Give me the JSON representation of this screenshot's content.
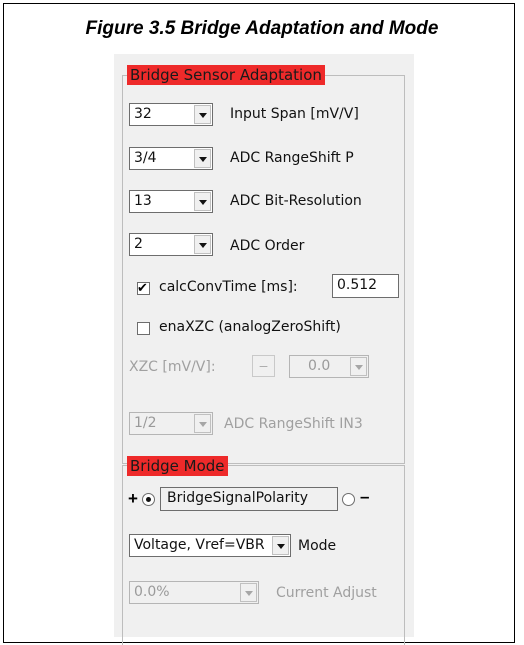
{
  "figure": {
    "title": "Figure 3.5   Bridge Adaptation and Mode"
  },
  "sensor_group": {
    "legend": "Bridge Sensor Adaptation",
    "input_span": {
      "value": "32",
      "label": "Input Span [mV/V]"
    },
    "adc_rangeshift_p": {
      "value": "3/4",
      "label": "ADC RangeShift P"
    },
    "adc_bit_resolution": {
      "value": "13",
      "label": "ADC Bit-Resolution"
    },
    "adc_order": {
      "value": "2",
      "label": "ADC Order"
    },
    "calc_conv_time": {
      "label": "calcConvTime [ms]:",
      "checked": true,
      "check_glyph": "✔",
      "value": "0.512"
    },
    "ena_xzc": {
      "label": "enaXZC (analogZeroShift)",
      "checked": false
    },
    "xzc": {
      "label": "XZC [mV/V]:",
      "button": "–",
      "value": "0.0"
    },
    "adc_rangeshift_in3": {
      "value": "1/2",
      "label": "ADC RangeShift IN3"
    }
  },
  "mode_group": {
    "legend": "Bridge Mode",
    "plus": "+",
    "minus": "–",
    "polarity_label": "BridgeSignalPolarity",
    "mode": {
      "value": "Voltage, Vref=VBR",
      "label": "Mode"
    },
    "current_adjust": {
      "value": "0.0%",
      "label": "Current Adjust"
    }
  }
}
